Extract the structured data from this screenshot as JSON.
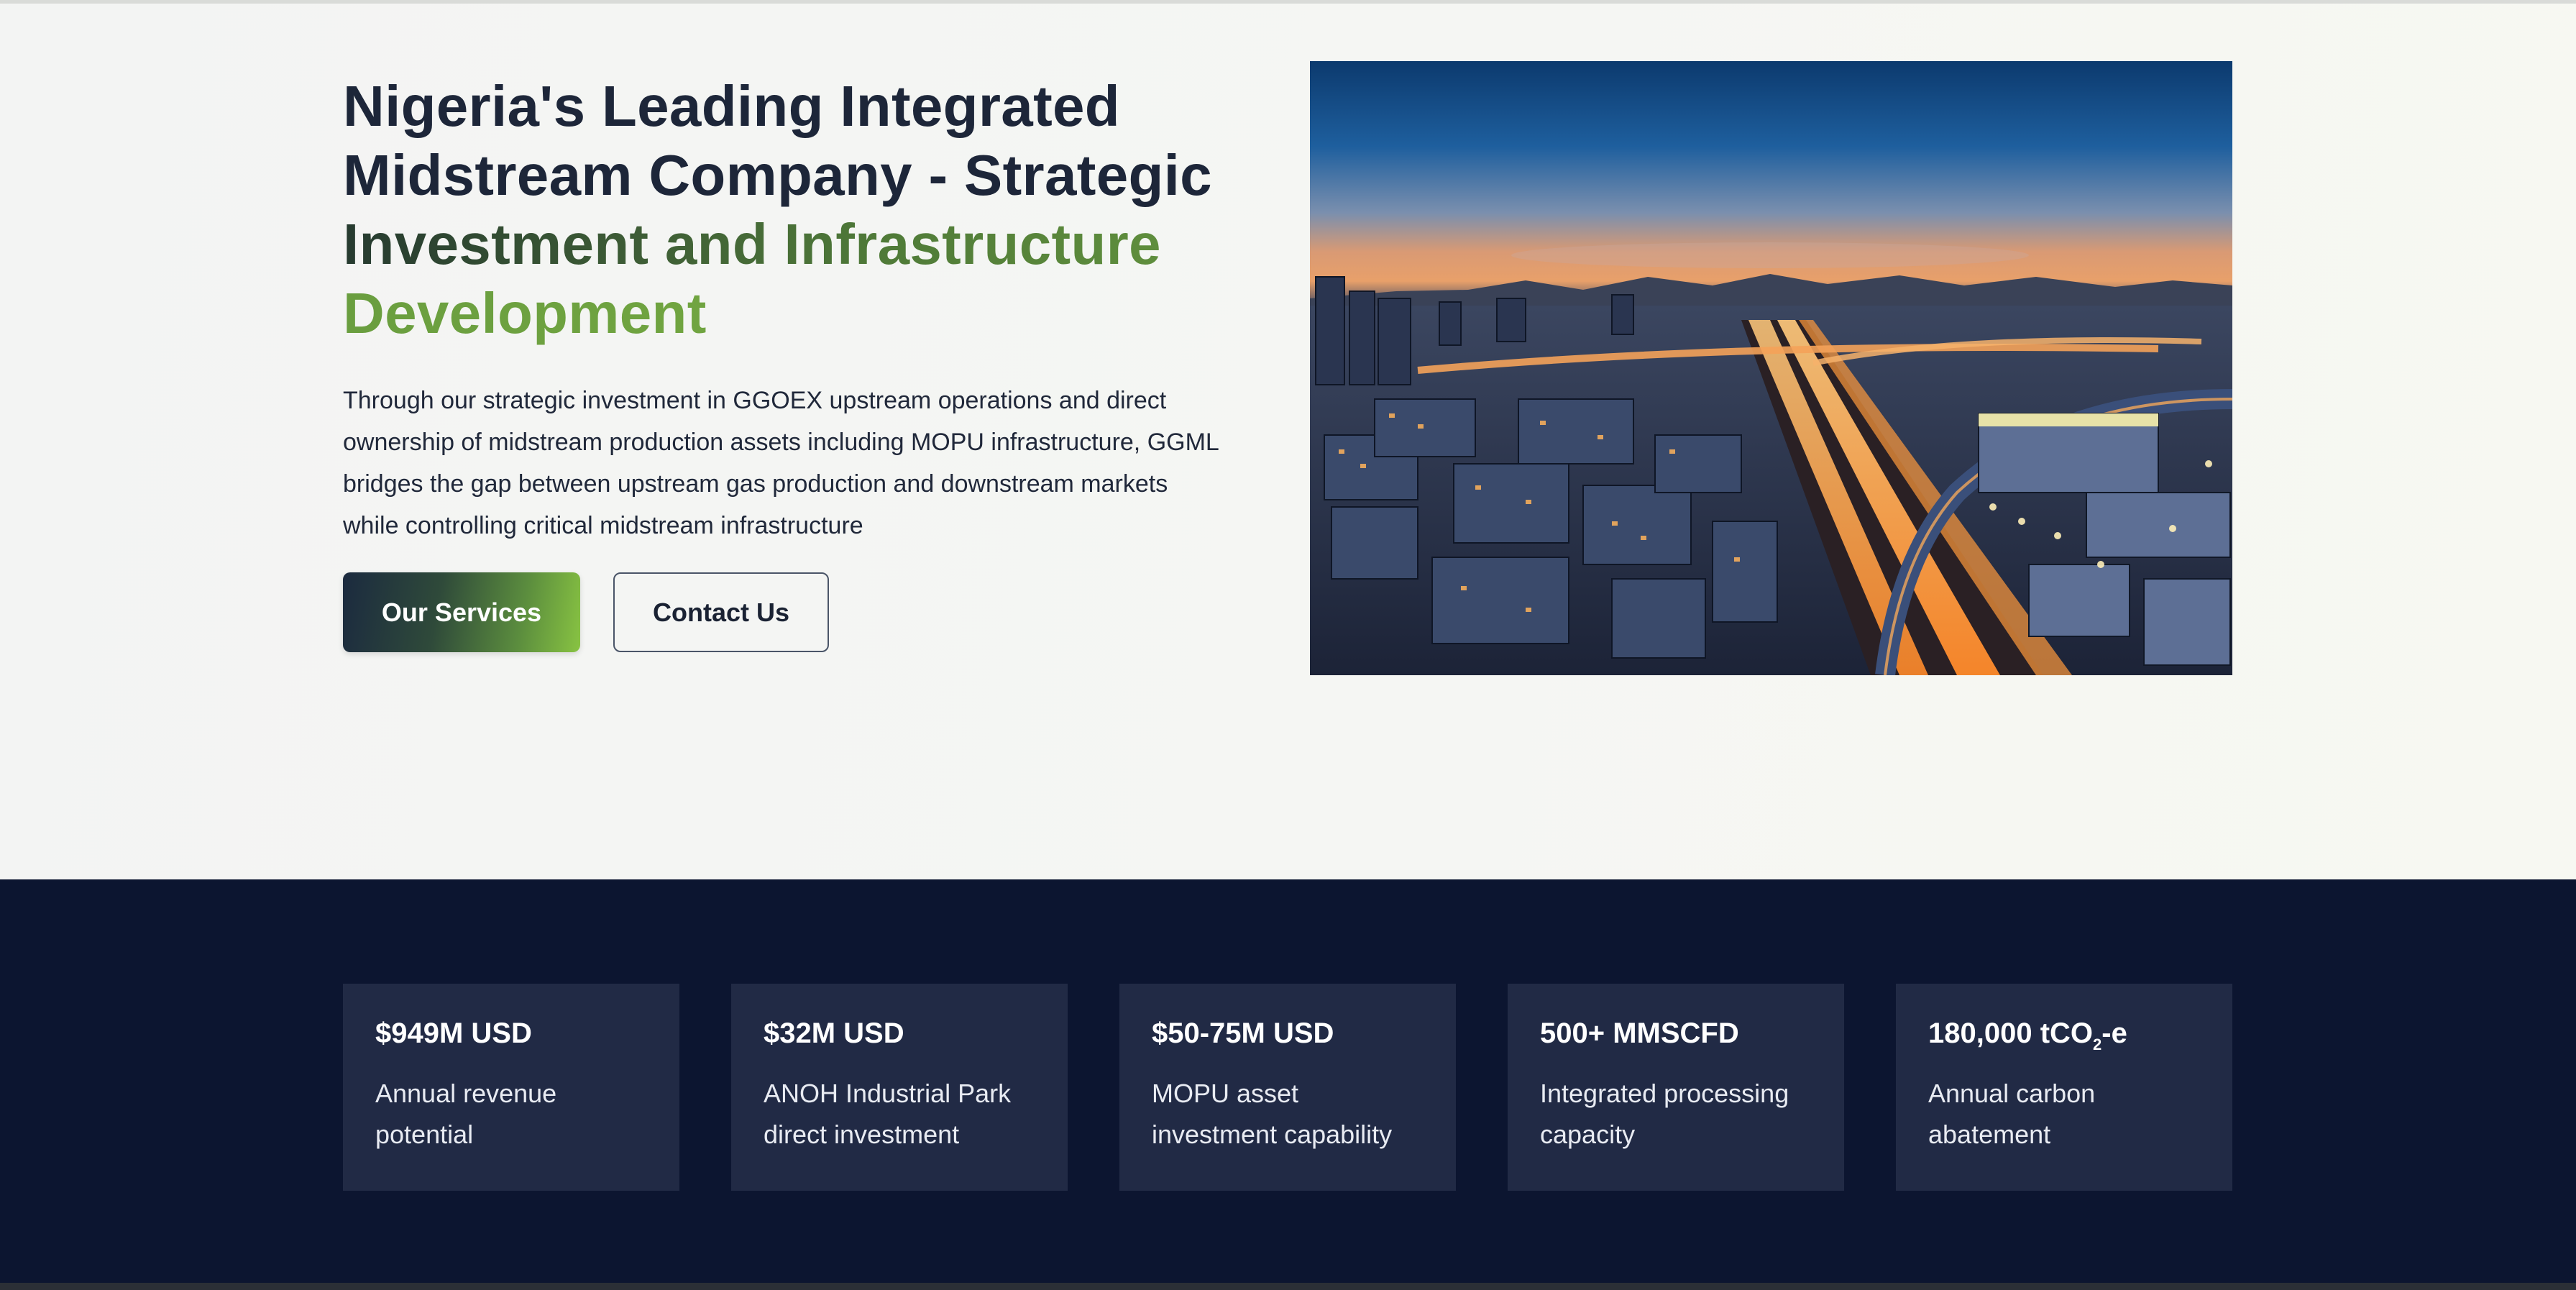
{
  "hero": {
    "headline_line1": "Nigeria's Leading Integrated",
    "headline_line2": "Midstream Company - Strategic",
    "headline_line3": "Investment and Infrastructure",
    "headline_line4": "Development",
    "description": "Through our strategic investment in GGOEX upstream operations and direct ownership of midstream production assets including MOPU infrastructure, GGML bridges the gap between upstream gas production and downstream markets while controlling critical midstream infrastructure",
    "primary_button_label": "Our Services",
    "secondary_button_label": "Contact Us",
    "image_alt": "City skyline at dusk with light-trail highways"
  },
  "stats": [
    {
      "value": "$949M USD",
      "label": "Annual revenue potential"
    },
    {
      "value": "$32M USD",
      "label": "ANOH Industrial Park direct investment"
    },
    {
      "value": "$50-75M USD",
      "label": "MOPU asset investment capability"
    },
    {
      "value": "500+ MMSCFD",
      "label": "Integrated processing capacity"
    },
    {
      "value_prefix": "180,000 tCO",
      "value_sub": "2",
      "value_suffix": "-e",
      "label": "Annual carbon abatement"
    }
  ],
  "colors": {
    "navy": "#0c1530",
    "card": "#212a45",
    "headline_dark": "#1d2639",
    "accent_green": "#79ad43"
  }
}
